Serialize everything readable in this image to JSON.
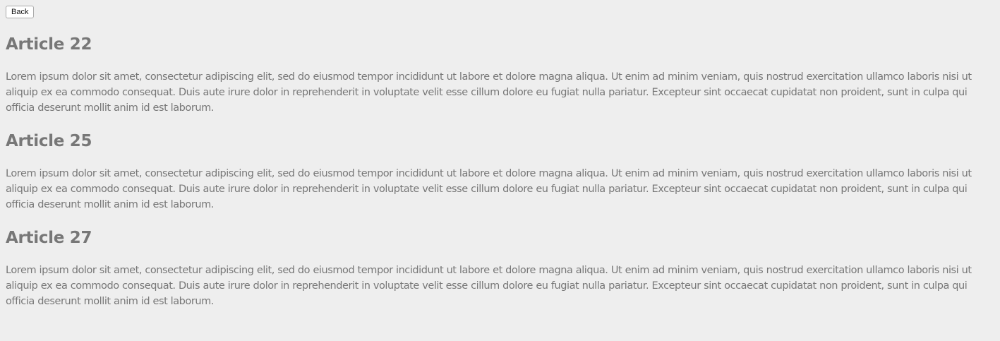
{
  "toolbar": {
    "back_label": "Back"
  },
  "articles": [
    {
      "title": "Article 22",
      "body": "Lorem ipsum dolor sit amet, consectetur adipiscing elit, sed do eiusmod tempor incididunt ut labore et dolore magna aliqua. Ut enim ad minim veniam, quis nostrud exercitation ullamco laboris nisi ut aliquip ex ea commodo consequat. Duis aute irure dolor in reprehenderit in voluptate velit esse cillum dolore eu fugiat nulla pariatur. Excepteur sint occaecat cupidatat non proident, sunt in culpa qui officia deserunt mollit anim id est laborum."
    },
    {
      "title": "Article 25",
      "body": "Lorem ipsum dolor sit amet, consectetur adipiscing elit, sed do eiusmod tempor incididunt ut labore et dolore magna aliqua. Ut enim ad minim veniam, quis nostrud exercitation ullamco laboris nisi ut aliquip ex ea commodo consequat. Duis aute irure dolor in reprehenderit in voluptate velit esse cillum dolore eu fugiat nulla pariatur. Excepteur sint occaecat cupidatat non proident, sunt in culpa qui officia deserunt mollit anim id est laborum."
    },
    {
      "title": "Article 27",
      "body": "Lorem ipsum dolor sit amet, consectetur adipiscing elit, sed do eiusmod tempor incididunt ut labore et dolore magna aliqua. Ut enim ad minim veniam, quis nostrud exercitation ullamco laboris nisi ut aliquip ex ea commodo consequat. Duis aute irure dolor in reprehenderit in voluptate velit esse cillum dolore eu fugiat nulla pariatur. Excepteur sint occaecat cupidatat non proident, sunt in culpa qui officia deserunt mollit anim id est laborum."
    }
  ],
  "colors": {
    "background": "#eeeeee",
    "text": "#777777"
  }
}
